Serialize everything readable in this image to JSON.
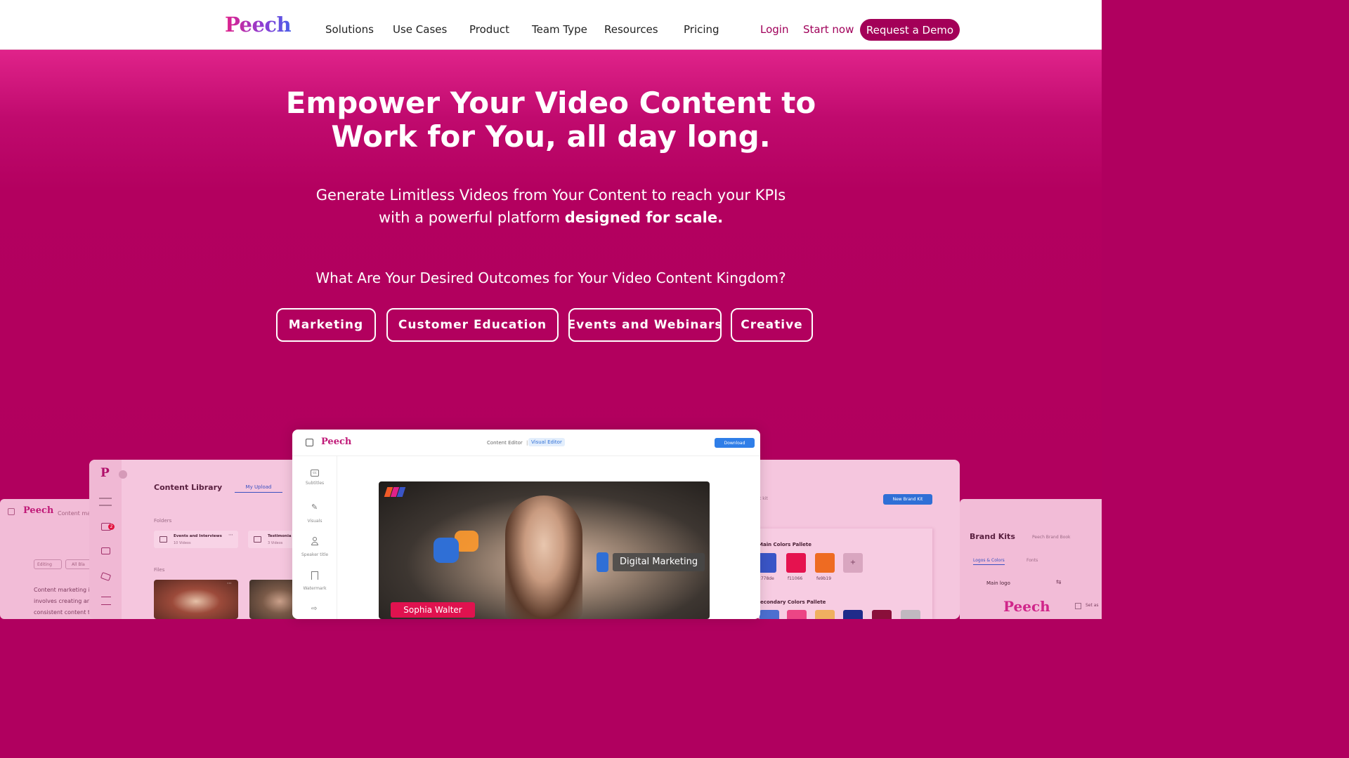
{
  "nav": {
    "logo": "Peech",
    "items": [
      "Solutions",
      "Use Cases",
      "Product",
      "Team Type",
      "Resources",
      "Pricing"
    ],
    "login": "Login",
    "start": "Start now",
    "demo": "Request a Demo"
  },
  "hero": {
    "headline_line1": "Empower Your Video Content to",
    "headline_line2": "Work for You, all day long.",
    "sub_line1": "Generate Limitless Videos from Your Content to reach your KPIs",
    "sub_line2_prefix": "with a powerful platform ",
    "sub_line2_bold": "designed for scale.",
    "question": "What Are Your Desired Outcomes for Your Video Content Kingdom?",
    "outcomes": [
      "Marketing",
      "Customer Education",
      "Events and Webinars",
      "Creative"
    ]
  },
  "mock_far_left": {
    "logo": "Peech",
    "crumb": "Content mar",
    "filter1": "Editing",
    "filter2": "All Bla",
    "text1": "Content marketing i",
    "text2": "involves creating an",
    "text3": "consistent content t"
  },
  "mock_library": {
    "logo": "P",
    "title": "Content Library",
    "tab": "My Upload",
    "folders_label": "Folders",
    "folder1_name": "Events and Interviews",
    "folder1_count": "10 Videos",
    "folder2_name": "Testimonia",
    "folder2_count": "3 Videos",
    "files_label": "Files",
    "badge": "2"
  },
  "mock_editor": {
    "logo": "Peech",
    "mode1": "Content Editor",
    "separator": "|",
    "mode2": "Visual Editor",
    "download": "Download",
    "tools": [
      "Subtitles",
      "Visuals",
      "Speaker title",
      "Watermark"
    ],
    "speaker_name": "Sophia Walter",
    "topic_label": "Digital Marketing"
  },
  "mock_brand": {
    "crumb": "t kit",
    "new_kit": "New Brand Kit",
    "main_colors_label": "Main Colors Pallete",
    "main_colors": [
      {
        "hex": "#3a55c7",
        "label": "2778de"
      },
      {
        "hex": "#e5124f",
        "label": "f11066"
      },
      {
        "hex": "#ee6b22",
        "label": "fe9b19"
      }
    ],
    "add": "+",
    "secondary_label": "Secondary Colors Pallete",
    "secondary_colors": [
      "#4c6fd0",
      "#ec4585",
      "#f0b060",
      "#1f2b8a",
      "#8a0f3a",
      "#c0b8c0"
    ]
  },
  "mock_far_right": {
    "title": "Brand Kits",
    "book": "Peech Brand Book",
    "tab1": "Logos & Colors",
    "tab2": "Fonts",
    "main_logo": "Main logo",
    "logo": "Peech",
    "set_as": "Set as"
  }
}
